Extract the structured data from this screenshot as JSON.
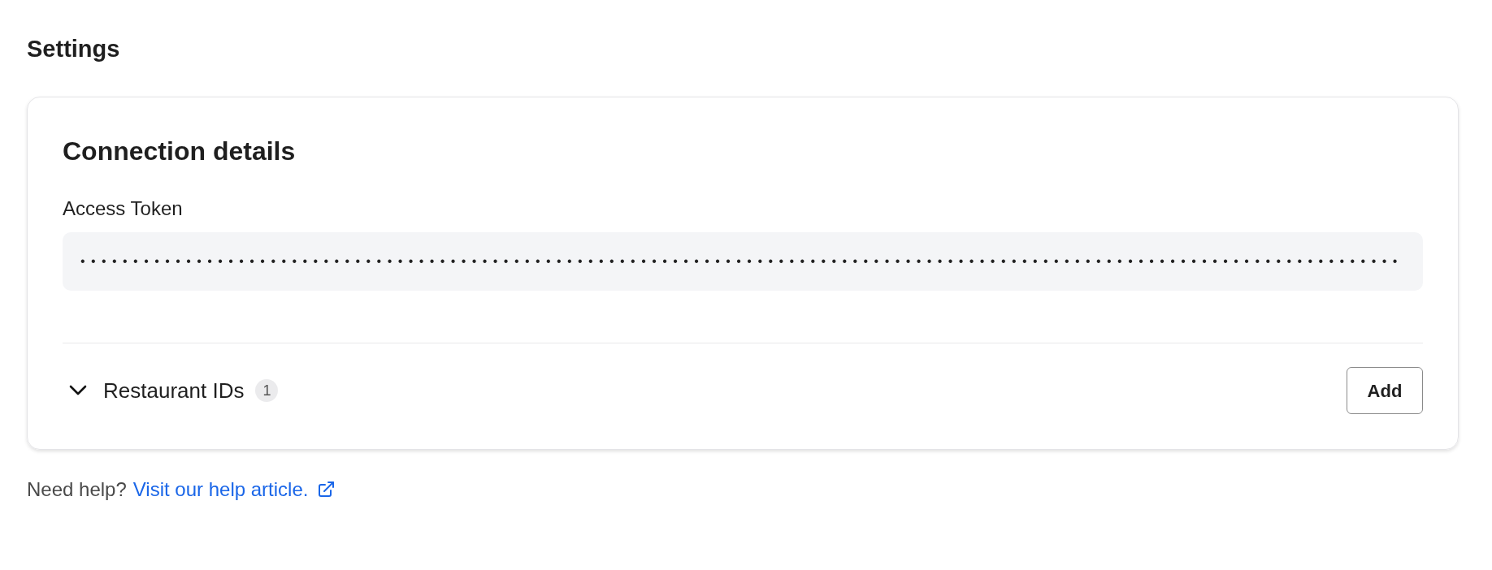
{
  "page": {
    "title": "Settings"
  },
  "card": {
    "title": "Connection details",
    "access_token": {
      "label": "Access Token",
      "value": "•••••••••••••••••••••••••••••••••••••••••••••••••••••••••••••••••••••••••••••••••••••••••••••••••••••••••••••••••••••••••••••"
    },
    "section": {
      "label": "Restaurant IDs",
      "count": "1",
      "expanded": false,
      "button": "Add"
    }
  },
  "help": {
    "text": "Need help?",
    "link": "Visit our help article."
  }
}
